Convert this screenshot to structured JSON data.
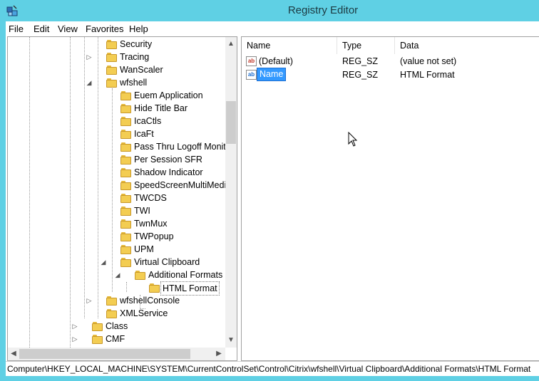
{
  "window": {
    "title": "Registry Editor"
  },
  "menu": [
    "File",
    "Edit",
    "View",
    "Favorites",
    "Help"
  ],
  "tree": [
    {
      "label": "Security",
      "level": 2,
      "expander": ""
    },
    {
      "label": "Tracing",
      "level": 2,
      "expander": "collapsed"
    },
    {
      "label": "WanScaler",
      "level": 2,
      "expander": ""
    },
    {
      "label": "wfshell",
      "level": 2,
      "expander": "expanded"
    },
    {
      "label": "Euem Application",
      "level": 3,
      "expander": ""
    },
    {
      "label": "Hide Title Bar",
      "level": 3,
      "expander": ""
    },
    {
      "label": "IcaCtls",
      "level": 3,
      "expander": ""
    },
    {
      "label": "IcaFt",
      "level": 3,
      "expander": ""
    },
    {
      "label": "Pass Thru Logoff Monito",
      "level": 3,
      "expander": ""
    },
    {
      "label": "Per Session SFR",
      "level": 3,
      "expander": ""
    },
    {
      "label": "Shadow Indicator",
      "level": 3,
      "expander": ""
    },
    {
      "label": "SpeedScreenMultiMedia",
      "level": 3,
      "expander": ""
    },
    {
      "label": "TWCDS",
      "level": 3,
      "expander": ""
    },
    {
      "label": "TWI",
      "level": 3,
      "expander": ""
    },
    {
      "label": "TwnMux",
      "level": 3,
      "expander": ""
    },
    {
      "label": "TWPopup",
      "level": 3,
      "expander": ""
    },
    {
      "label": "UPM",
      "level": 3,
      "expander": ""
    },
    {
      "label": "Virtual Clipboard",
      "level": 3,
      "expander": "expanded"
    },
    {
      "label": "Additional Formats",
      "level": 4,
      "expander": "expanded"
    },
    {
      "label": "HTML Format",
      "level": 5,
      "expander": "",
      "selected": true
    },
    {
      "label": "wfshellConsole",
      "level": 2,
      "expander": "collapsed"
    },
    {
      "label": "XMLService",
      "level": 2,
      "expander": ""
    },
    {
      "label": "Class",
      "level": 1,
      "expander": "collapsed"
    },
    {
      "label": "CMF",
      "level": 1,
      "expander": "collapsed"
    }
  ],
  "list": {
    "columns": [
      "Name",
      "Type",
      "Data"
    ],
    "rows": [
      {
        "name": "(Default)",
        "type": "REG_SZ",
        "data": "(value not set)",
        "editing": false
      },
      {
        "name": "Name",
        "type": "REG_SZ",
        "data": "HTML Format",
        "editing": true
      }
    ]
  },
  "icons": {
    "app": "registry-editor-icon",
    "folder": "folder-icon",
    "value": "string-value-icon"
  },
  "status": {
    "path": "Computer\\HKEY_LOCAL_MACHINE\\SYSTEM\\CurrentControlSet\\Control\\Citrix\\wfshell\\Virtual Clipboard\\Additional Formats\\HTML Format"
  },
  "colors": {
    "titlebar": "#5fd0e4",
    "selection": "#3399ff",
    "folder": "#f3cd52"
  }
}
